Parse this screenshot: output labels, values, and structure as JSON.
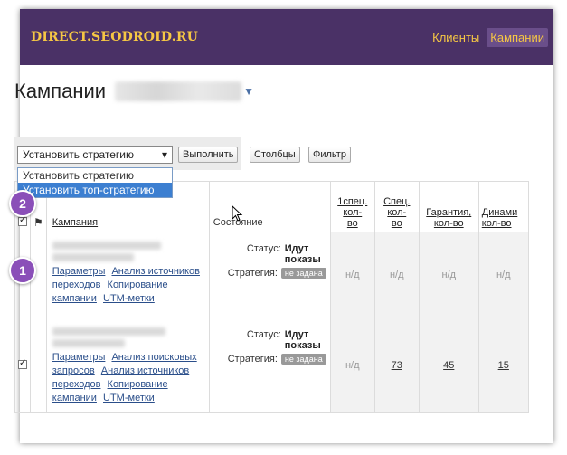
{
  "header": {
    "brand": "DIRECT.SEODROID.RU",
    "nav": [
      {
        "label": "Клиенты",
        "active": false
      },
      {
        "label": "Кампании",
        "active": true
      }
    ]
  },
  "page": {
    "title": "Кампании"
  },
  "toolbar": {
    "select_value": "Установить стратегию",
    "select_arrow": "▾",
    "execute_label": "Выполнить",
    "columns_label": "Столбцы",
    "filter_label": "Фильтр",
    "dropdown_options": [
      "Установить стратегию",
      "Установить топ-стратегию"
    ],
    "dropdown_selected_index": 1
  },
  "markers": [
    "1",
    "2"
  ],
  "table": {
    "headers": {
      "campaign": "Кампания",
      "state": "Состояние",
      "col1": [
        "1спец.",
        "кол-",
        "во"
      ],
      "col2": [
        "Спец.",
        "кол-",
        "во"
      ],
      "col3": [
        "Гарантия,",
        "кол-во"
      ],
      "col4": [
        "Динами",
        "кол-во"
      ]
    },
    "rows": [
      {
        "checked": true,
        "links": [
          "Параметры",
          "Анализ источников переходов",
          "Копирование кампании",
          "UTM-метки"
        ],
        "status_label": "Статус:",
        "status_value": "Идут показы",
        "strategy_label": "Стратегия:",
        "strategy_value": "не задана",
        "values": [
          "н/д",
          "н/д",
          "н/д",
          "н/д"
        ]
      },
      {
        "checked": true,
        "links": [
          "Параметры",
          "Анализ поисковых запросов",
          "Анализ источников переходов",
          "Копирование кампании",
          "UTM-метки"
        ],
        "status_label": "Статус:",
        "status_value": "Идут показы",
        "strategy_label": "Стратегия:",
        "strategy_value": "не задана",
        "values": [
          "н/д",
          "73",
          "45",
          "15"
        ]
      }
    ]
  },
  "colors": {
    "topbar": "#4a3166",
    "brand": "#f6c744",
    "marker": "#8a4fb8",
    "dropdown_highlight": "#3c7fd1"
  }
}
